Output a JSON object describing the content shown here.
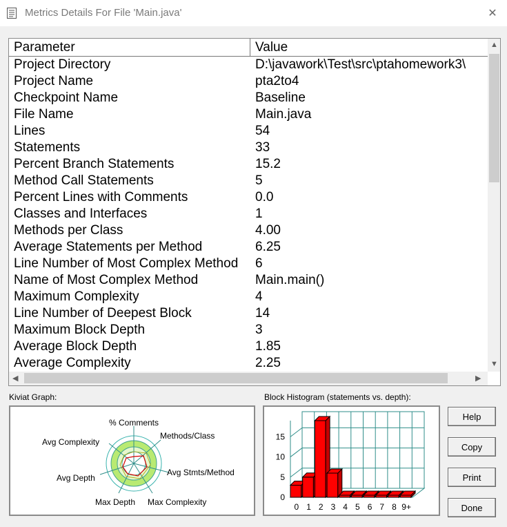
{
  "window": {
    "title": "Metrics Details For File 'Main.java'",
    "close_glyph": "✕"
  },
  "table": {
    "headers": [
      "Parameter",
      "Value"
    ],
    "rows": [
      {
        "param": "Project Directory",
        "value": "D:\\javawork\\Test\\src\\ptahomework3\\"
      },
      {
        "param": "Project Name",
        "value": "pta2to4"
      },
      {
        "param": "Checkpoint Name",
        "value": "Baseline"
      },
      {
        "param": "File Name",
        "value": "Main.java"
      },
      {
        "param": "Lines",
        "value": "54"
      },
      {
        "param": "Statements",
        "value": "33"
      },
      {
        "param": "Percent Branch Statements",
        "value": "15.2"
      },
      {
        "param": "Method Call Statements",
        "value": "5"
      },
      {
        "param": "Percent Lines with Comments",
        "value": "0.0"
      },
      {
        "param": "Classes and Interfaces",
        "value": "1"
      },
      {
        "param": "Methods per Class",
        "value": "4.00"
      },
      {
        "param": "Average Statements per Method",
        "value": "6.25"
      },
      {
        "param": "Line Number of Most Complex Method",
        "value": "6"
      },
      {
        "param": "Name of Most Complex Method",
        "value": "Main.main()"
      },
      {
        "param": "Maximum Complexity",
        "value": "4"
      },
      {
        "param": "Line Number of Deepest Block",
        "value": "14"
      },
      {
        "param": "Maximum Block Depth",
        "value": "3"
      },
      {
        "param": "Average Block Depth",
        "value": "1.85"
      },
      {
        "param": "Average Complexity",
        "value": "2.25"
      }
    ]
  },
  "kiviat": {
    "label": "Kiviat Graph:",
    "axes": [
      "% Comments",
      "Methods/Class",
      "Avg Stmts/Method",
      "Max Complexity",
      "Max Depth",
      "Avg Depth",
      "Avg Complexity"
    ]
  },
  "histogram": {
    "label": "Block Histogram (statements vs. depth):",
    "y_ticks": [
      "0",
      "5",
      "10",
      "15"
    ],
    "bar_color": "#ff0000"
  },
  "buttons": {
    "help": "Help",
    "copy": "Copy",
    "print": "Print",
    "done": "Done"
  },
  "chart_data": {
    "type": "bar",
    "categories": [
      "0",
      "1",
      "2",
      "3",
      "4",
      "5",
      "6",
      "7",
      "8",
      "9+"
    ],
    "values": [
      3,
      5,
      19,
      6,
      0,
      0,
      0,
      0,
      0,
      0
    ],
    "title": "",
    "xlabel": "",
    "ylabel": "",
    "ylim": [
      0,
      19
    ]
  }
}
